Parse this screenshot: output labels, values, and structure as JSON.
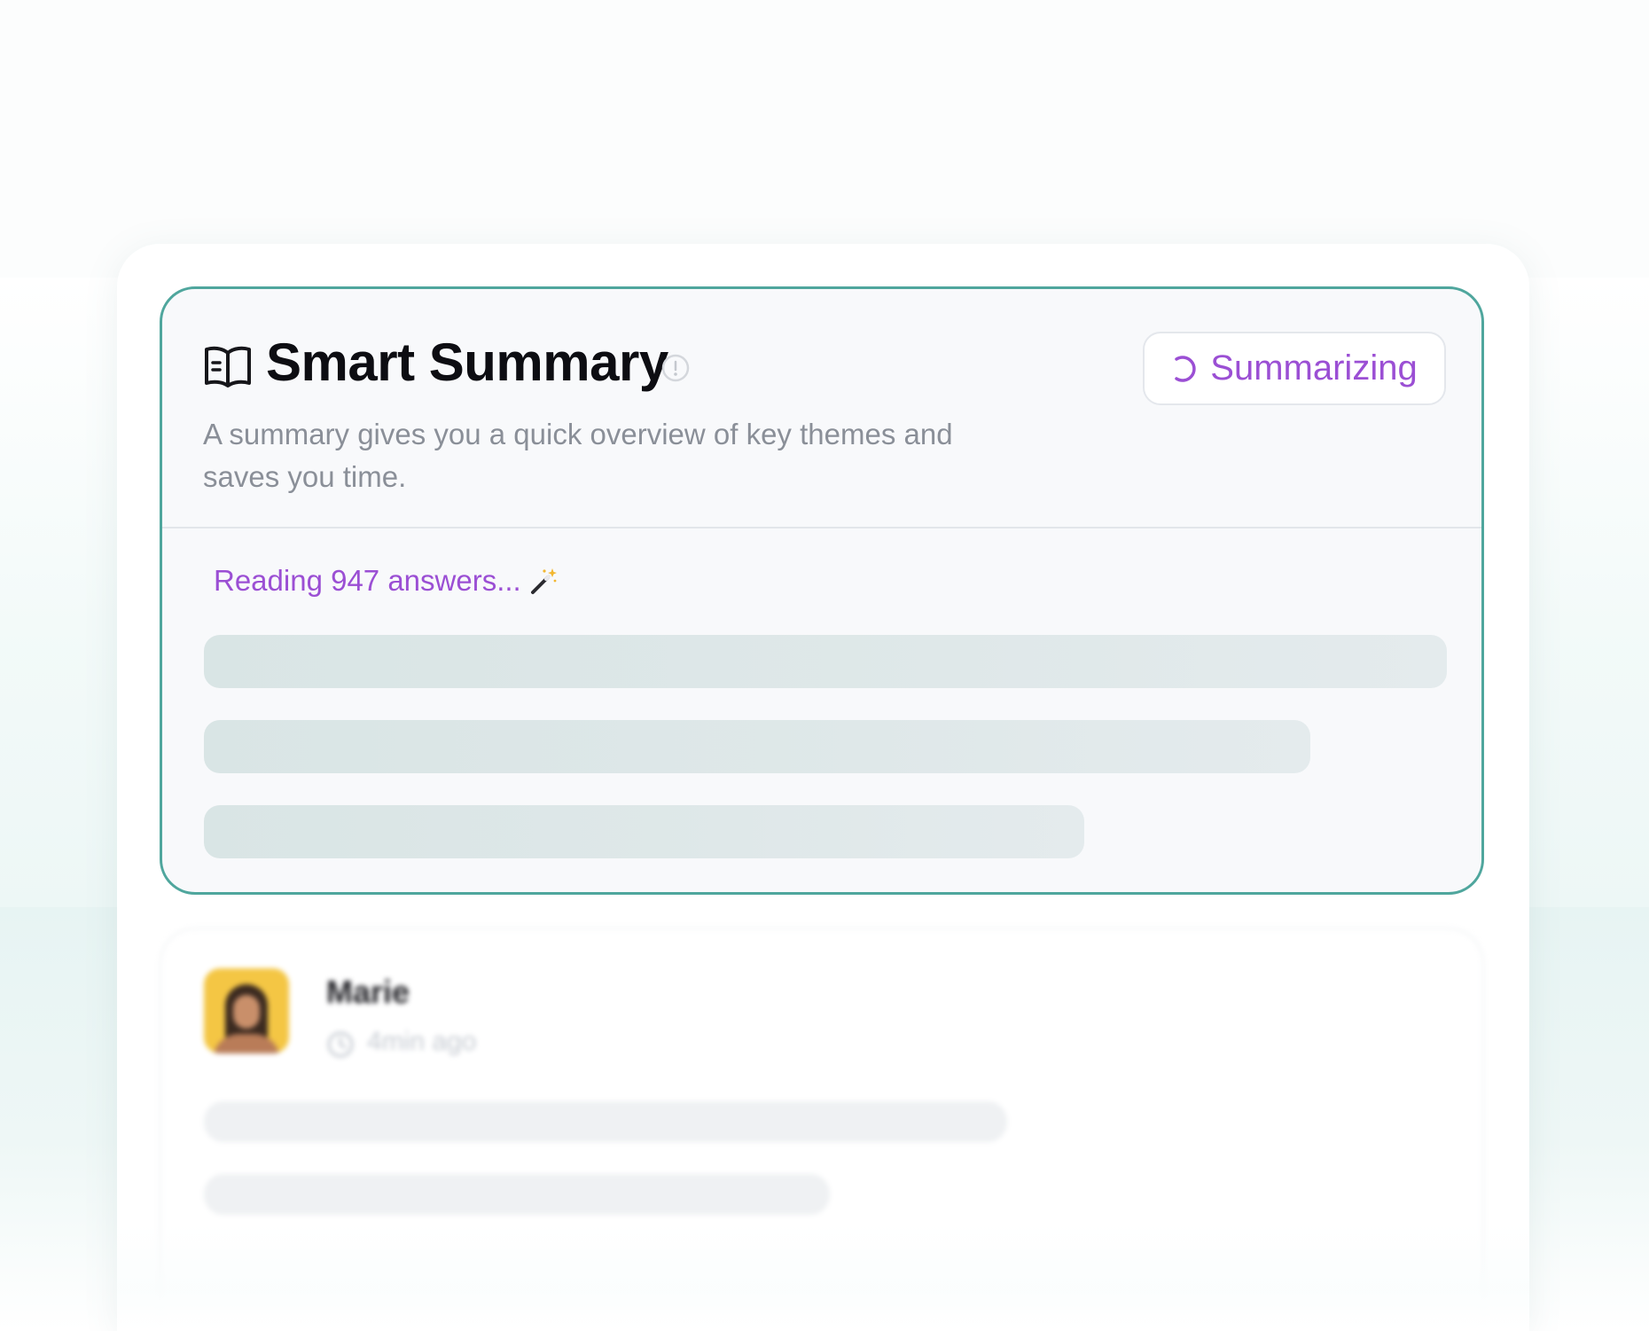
{
  "summary_card": {
    "title": "Smart Summary",
    "title_icon": "book-icon",
    "info_icon": "info-icon",
    "subtitle": "A summary gives you a quick overview of key themes and saves you time.",
    "status_button": {
      "label": "Summarizing",
      "icon": "spinner-icon"
    },
    "progress_text": "Reading 947 answers...",
    "progress_icon": "magic-wand-icon"
  },
  "comment": {
    "author": "Marie",
    "time": "4min ago",
    "time_icon": "clock-icon"
  },
  "colors": {
    "accent_purple": "#9b4fd4",
    "card_border_teal": "#4fa69d",
    "skeleton": "#dbe6e6",
    "avatar_bg": "#f4c644"
  }
}
